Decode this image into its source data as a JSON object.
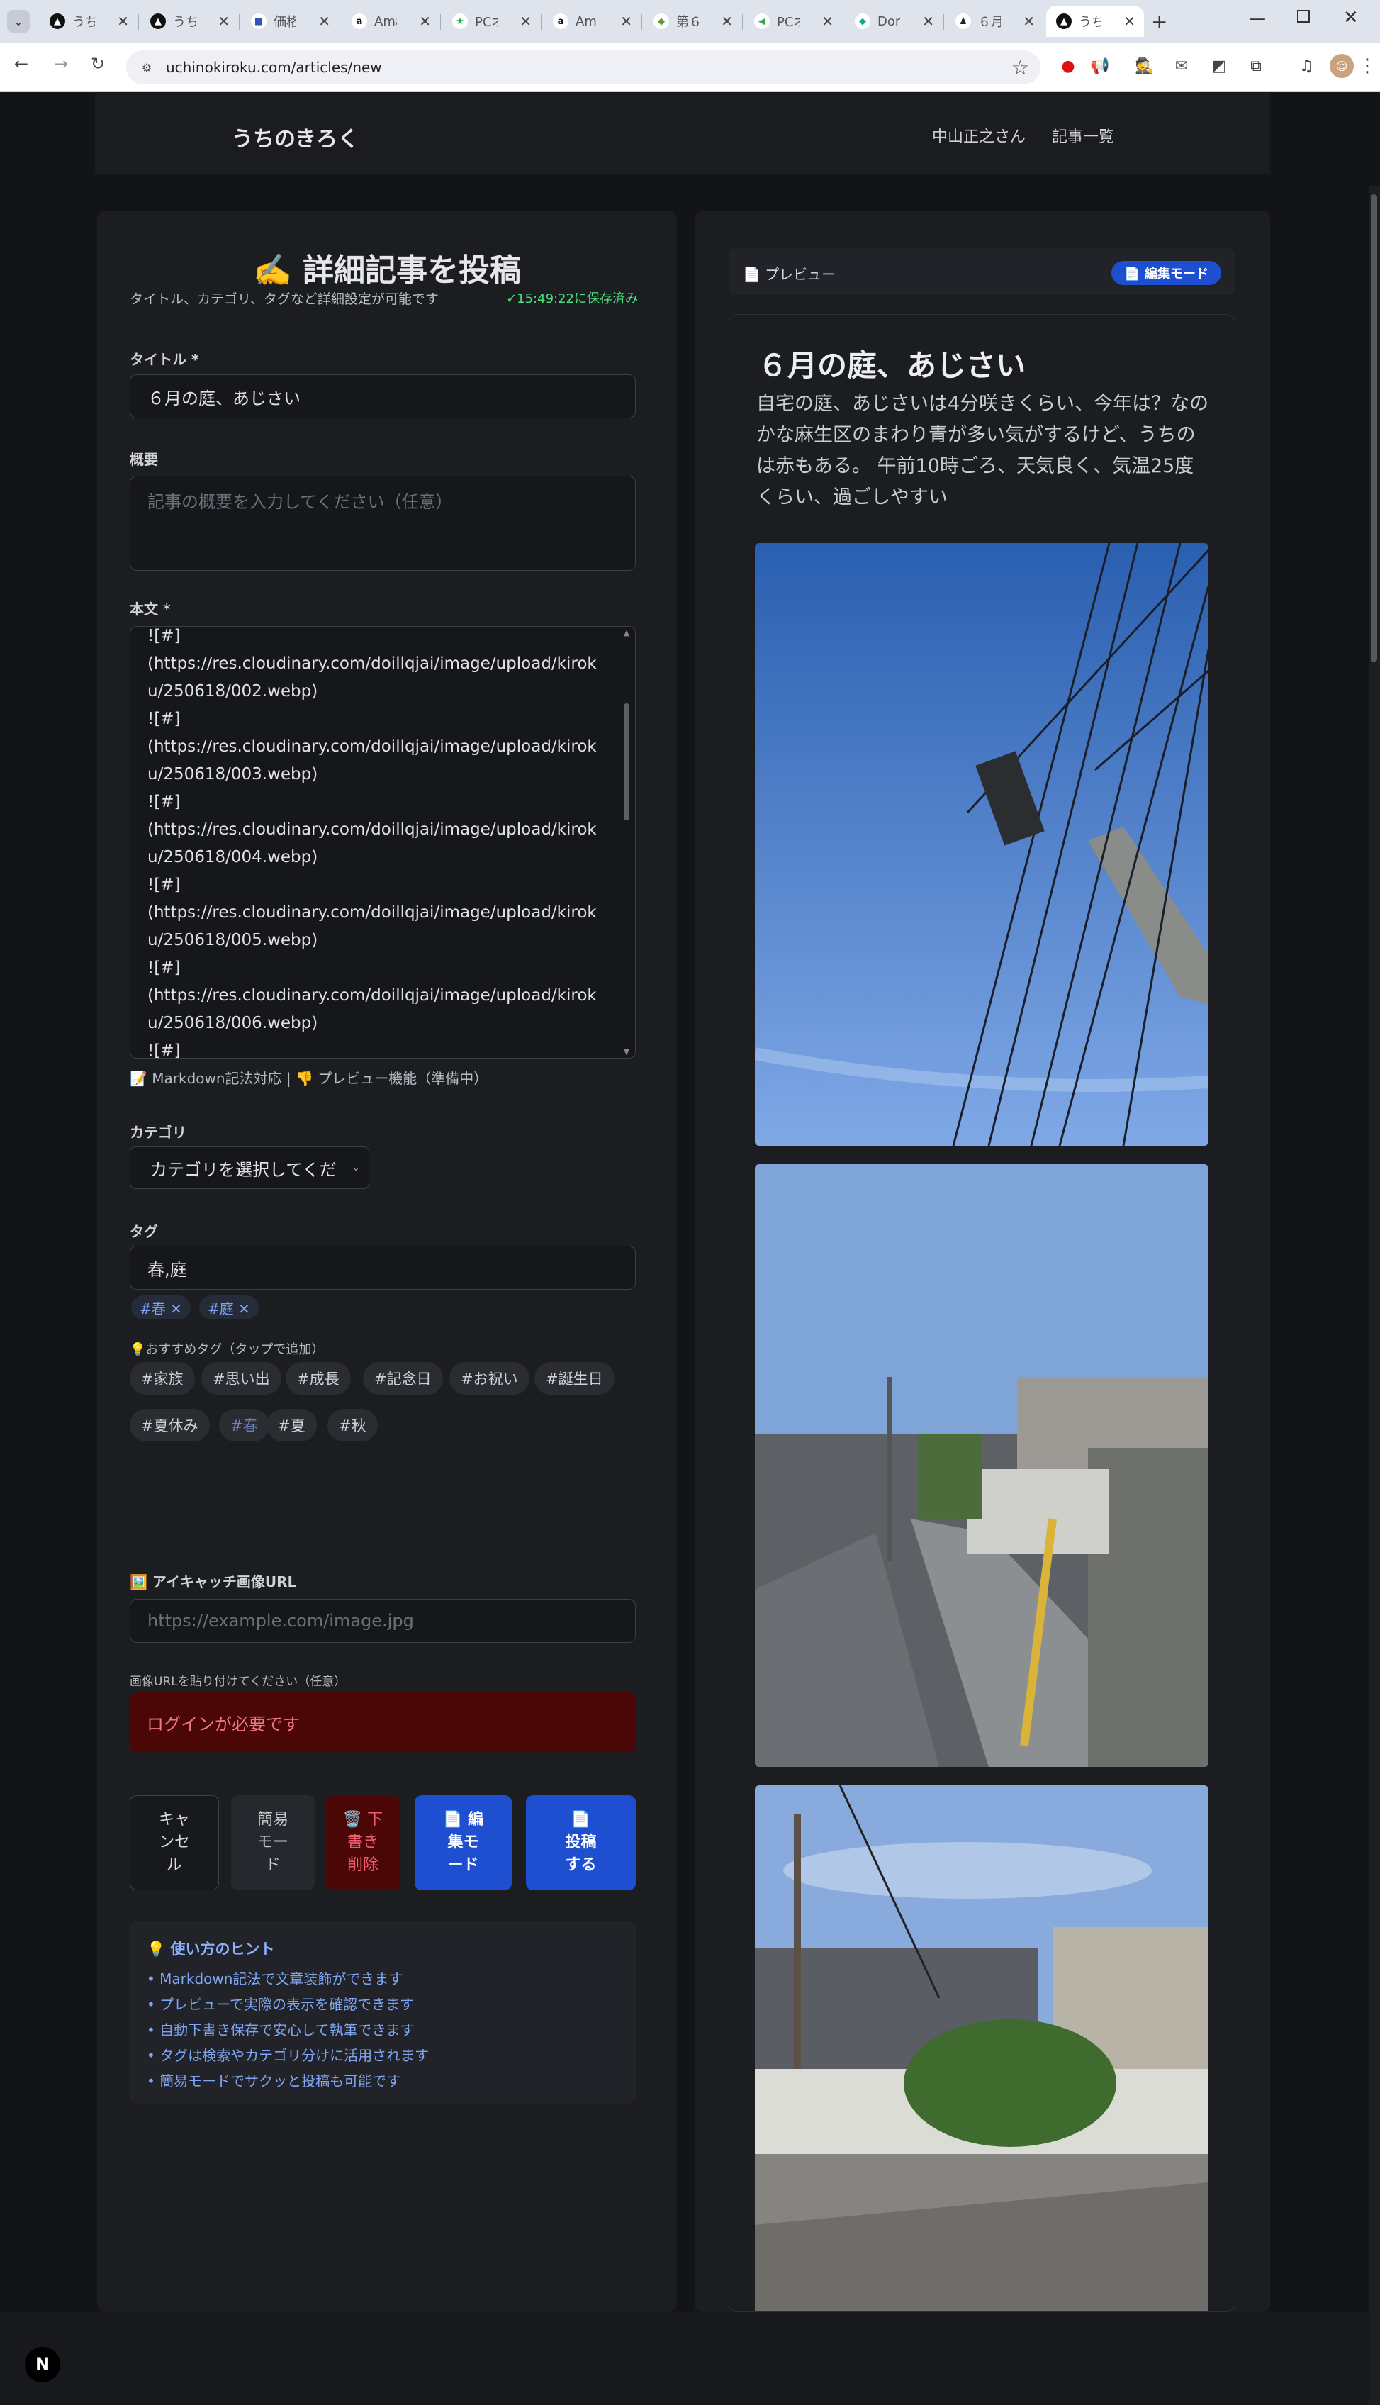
{
  "browser": {
    "tabs": [
      {
        "label": "うち",
        "fav": "▲",
        "fav_bg": "#111",
        "fav_fg": "#fff"
      },
      {
        "label": "うち",
        "fav": "▲",
        "fav_bg": "#111",
        "fav_fg": "#fff"
      },
      {
        "label": "価格",
        "fav": "■",
        "fav_bg": "#fff",
        "fav_fg": "#3a52b5"
      },
      {
        "label": "Ama",
        "fav": "a",
        "fav_bg": "#fff",
        "fav_fg": "#111"
      },
      {
        "label": "PCオ",
        "fav": "★",
        "fav_bg": "#fff",
        "fav_fg": "#2fa84f"
      },
      {
        "label": "Ama",
        "fav": "a",
        "fav_bg": "#fff",
        "fav_fg": "#111"
      },
      {
        "label": "第６",
        "fav": "◆",
        "fav_bg": "#fff",
        "fav_fg": "#5a9b2e"
      },
      {
        "label": "PCオ",
        "fav": "◀",
        "fav_bg": "#fff",
        "fav_fg": "#2fa84f"
      },
      {
        "label": "Don",
        "fav": "◆",
        "fav_bg": "#fff",
        "fav_fg": "#1aa38c"
      },
      {
        "label": "６月",
        "fav": "♟",
        "fav_bg": "#fff",
        "fav_fg": "#222"
      },
      {
        "label": "うち",
        "fav": "▲",
        "fav_bg": "#111",
        "fav_fg": "#fff"
      }
    ],
    "url": "uchinokiroku.com/articles/new"
  },
  "header": {
    "logo": "うちのきろく",
    "user": "中山正之さん",
    "articles_link": "記事一覧"
  },
  "form": {
    "title": "✍️ 詳細記事を投稿",
    "subtitle": "タイトル、カテゴリ、タグなど詳細設定が可能です",
    "saved_status": "✓15:49:22に保存済み",
    "title_label": "タイトル *",
    "title_value": "６月の庭、あじさい",
    "summary_label": "概要",
    "summary_placeholder": "記事の概要を入力してください（任意）",
    "body_label": "本文 *",
    "body_lines": [
      "![#]",
      "(https://res.cloudinary.com/doillqjai/image/upload/kirok",
      "u/250618/002.webp)",
      "![#]",
      "(https://res.cloudinary.com/doillqjai/image/upload/kirok",
      "u/250618/003.webp)",
      "![#]",
      "(https://res.cloudinary.com/doillqjai/image/upload/kirok",
      "u/250618/004.webp)",
      "![#]",
      "(https://res.cloudinary.com/doillqjai/image/upload/kirok",
      "u/250618/005.webp)",
      "![#]",
      "(https://res.cloudinary.com/doillqjai/image/upload/kirok",
      "u/250618/006.webp)",
      "![#]"
    ],
    "body_help": "📝 Markdown記法対応 | 👎 プレビュー機能（準備中）",
    "category_label": "カテゴリ",
    "category_value": "カテゴリを選択してくだ",
    "tags_label": "タグ",
    "tags_value": "春,庭",
    "tag_chips": [
      "#春 ✕",
      "#庭 ✕"
    ],
    "recommended_hint": "💡おすすめタグ（タップで追加）",
    "recommended_tags": [
      "#家族",
      "#思い出",
      "#成長",
      "#記念日",
      "#お祝い",
      "#誕生日",
      "#夏休み",
      "#春",
      "#夏",
      "#秋"
    ],
    "eyecatch_label": "🖼️ アイキャッチ画像URL",
    "eyecatch_placeholder": "https://example.com/image.jpg",
    "eyecatch_note": "画像URLを貼り付けてください（任意）",
    "error": "ログインが必要です",
    "buttons": {
      "cancel": [
        "キャ",
        "ンセ",
        "ル"
      ],
      "simple": [
        "簡易",
        "モー",
        "ド"
      ],
      "delete_draft": [
        "🗑️ 下",
        "書き",
        "削除"
      ],
      "edit_mode": [
        "📄 編",
        "集モ",
        "ード"
      ],
      "post": [
        "📄",
        "投稿",
        "する"
      ]
    },
    "hints_title": "💡 使い方のヒント",
    "hints": [
      "• Markdown記法で文章装飾ができます",
      "• プレビューで実際の表示を確認できます",
      "• 自動下書き保存で安心して執筆できます",
      "• タグは検索やカテゴリ分けに活用されます",
      "• 簡易モードでサクッと投稿も可能です"
    ]
  },
  "preview": {
    "label": "📄 プレビュー",
    "edit_mode_button": "📄 編集モード",
    "title": "６月の庭、あじさい",
    "body": "自宅の庭、あじさいは4分咲きくらい、今年は？なのかな麻生区のまわり青が多い気がするけど、うちのは赤もある。 午前10時ごろ、天気良く、気温25度くらい、過ごしやすい"
  },
  "colors": {
    "accent": "#1e4fd0",
    "error_bg": "#4b0606",
    "saved": "#4ade80"
  }
}
